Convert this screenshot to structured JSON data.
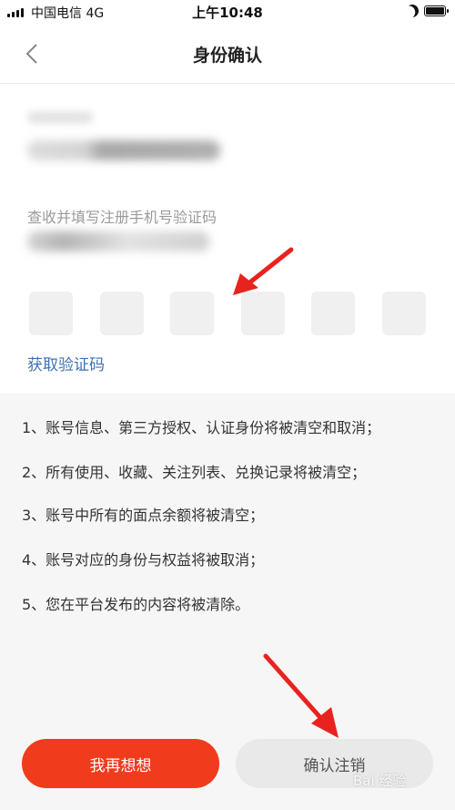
{
  "status_bar": {
    "carrier": "中国电信 4G",
    "time": "上午10:48"
  },
  "nav": {
    "title": "身份确认"
  },
  "verify": {
    "hint": "查收并填写注册手机号验证码",
    "code_box_count": 6,
    "get_code_label": "获取验证码"
  },
  "notice": {
    "items": [
      "1、账号信息、第三方授权、认证身份将被清空和取消；",
      "2、所有使用、收藏、关注列表、兑换记录将被清空；",
      "3、账号中所有的面点余额将被清空；",
      "4、账号对应的身份与权益将被取消；",
      "5、您在平台发布的内容将被清除。"
    ]
  },
  "buttons": {
    "rethink_label": "我再想想",
    "confirm_label": "确认注销"
  },
  "colors": {
    "primary": "#f03c1c",
    "link": "#3f72b5",
    "annotation_arrow": "#e8231f"
  },
  "watermark": "Bai 经验"
}
